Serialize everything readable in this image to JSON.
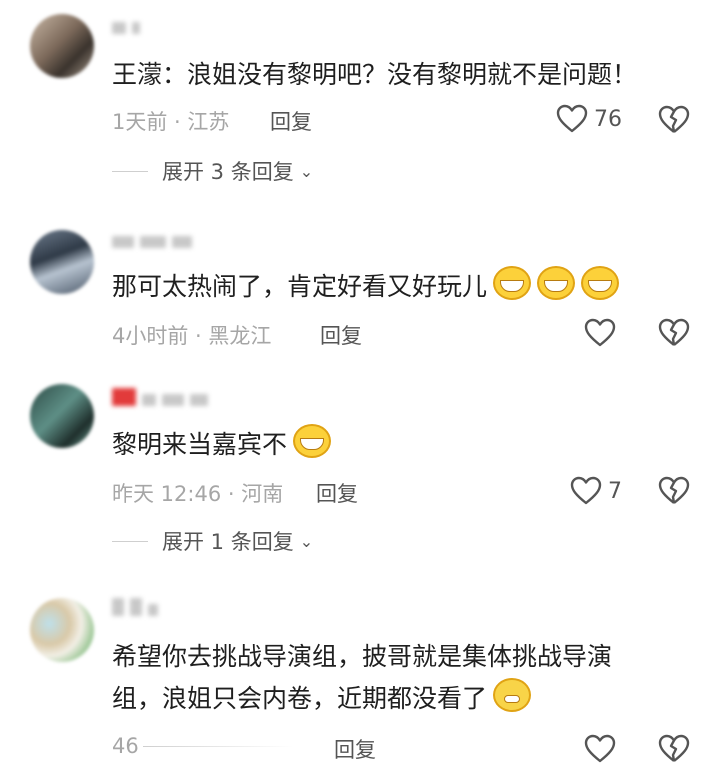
{
  "comments": [
    {
      "text": "王濛：浪姐没有黎明吧？没有黎明就不是问题！",
      "meta": "1天前 · 江苏",
      "reply": "回复",
      "likes": "76",
      "expand": "展开 3 条回复"
    },
    {
      "text": "那可太热闹了，肯定好看又好玩儿",
      "meta": "4小时前 · 黑龙江",
      "reply": "回复",
      "likes": ""
    },
    {
      "text": "黎明来当嘉宾不",
      "meta": "昨天 12:46 · 河南",
      "reply": "回复",
      "likes": "7",
      "expand": "展开 1 条回复"
    },
    {
      "text_line1": "希望你去挑战导演组，披哥就是集体挑战导演",
      "text_line2": "组，浪姐只会内卷，近期都没看了",
      "meta": "46",
      "reply": "回复"
    }
  ],
  "icons": {
    "like": "heart-outline-icon",
    "dislike": "broken-heart-icon",
    "expand": "chevron-down-icon",
    "emoji": "grinning-face-icon"
  },
  "colors": {
    "text": "#1f1f1f",
    "meta": "#a6a6a6",
    "action": "#555555"
  }
}
